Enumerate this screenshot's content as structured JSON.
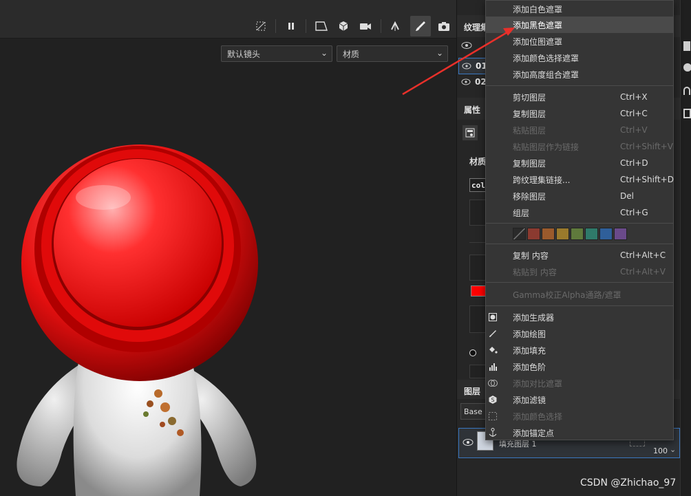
{
  "viewport": {
    "camera_select": "默认镜头",
    "material_select": "材质"
  },
  "panel": {
    "texture_set_header": "纹理集",
    "layer_row_1": "01",
    "layer_row_2": "02",
    "properties_header": "属性",
    "material_label": "材质",
    "color_label": "col",
    "color_swatch_value": "#ff0000",
    "layers_header": "图层",
    "blend_mode_value": "Base",
    "fill_layer_name": "填充图层 1",
    "opacity_value": "100"
  },
  "menu": {
    "items": [
      {
        "label": "添加白色遮罩",
        "shortcut": "",
        "disabled": false
      },
      {
        "label": "添加黑色遮罩",
        "shortcut": "",
        "disabled": false,
        "hover": true
      },
      {
        "label": "添加位图遮罩",
        "shortcut": "",
        "disabled": false
      },
      {
        "label": "添加颜色选择遮罩",
        "shortcut": "",
        "disabled": false
      },
      {
        "label": "添加高度组合遮罩",
        "shortcut": "",
        "disabled": false
      },
      {
        "label": "剪切图层",
        "shortcut": "Ctrl+X",
        "disabled": false
      },
      {
        "label": "复制图层",
        "shortcut": "Ctrl+C",
        "disabled": false
      },
      {
        "label": "粘贴图层",
        "shortcut": "Ctrl+V",
        "disabled": true
      },
      {
        "label": "粘贴图层作为链接",
        "shortcut": "Ctrl+Shift+V",
        "disabled": true
      },
      {
        "label": "复制图层",
        "shortcut": "Ctrl+D",
        "disabled": false
      },
      {
        "label": "跨纹理集链接...",
        "shortcut": "Ctrl+Shift+D",
        "disabled": false
      },
      {
        "label": "移除图层",
        "shortcut": "Del",
        "disabled": false
      },
      {
        "label": "组层",
        "shortcut": "Ctrl+G",
        "disabled": false
      },
      {
        "label": "复制 内容",
        "shortcut": "Ctrl+Alt+C",
        "disabled": false
      },
      {
        "label": "粘贴到 内容",
        "shortcut": "Ctrl+Alt+V",
        "disabled": true
      },
      {
        "label": "Gamma校正Alpha通路/遮罩",
        "shortcut": "",
        "disabled": true
      },
      {
        "label": "添加生成器",
        "shortcut": "",
        "disabled": false,
        "icon": "generator-icon"
      },
      {
        "label": "添加绘图",
        "shortcut": "",
        "disabled": false,
        "icon": "brush-icon"
      },
      {
        "label": "添加填充",
        "shortcut": "",
        "disabled": false,
        "icon": "fill-bucket-icon"
      },
      {
        "label": "添加色阶",
        "shortcut": "",
        "disabled": false,
        "icon": "levels-icon"
      },
      {
        "label": "添加对比遮罩",
        "shortcut": "",
        "disabled": true,
        "icon": "compare-mask-icon"
      },
      {
        "label": "添加滤镜",
        "shortcut": "",
        "disabled": false,
        "icon": "filter-icon"
      },
      {
        "label": "添加颜色选择",
        "shortcut": "",
        "disabled": true,
        "icon": "color-selection-icon"
      },
      {
        "label": "添加锚定点",
        "shortcut": "",
        "disabled": false,
        "icon": "anchor-icon"
      }
    ],
    "swatch_colors": [
      "#2a2a2a",
      "#8b3a30",
      "#9a5a2c",
      "#9a7a2c",
      "#5f7a3c",
      "#2f7a6a",
      "#2f5f9a",
      "#6a4a8a"
    ]
  },
  "watermark": "CSDN @Zhichao_97",
  "colors": {
    "accent_red": "#e8302a",
    "menu_bg": "#353535",
    "hover_bg": "#4a4a4a"
  }
}
